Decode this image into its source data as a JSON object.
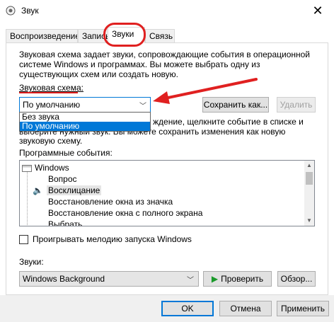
{
  "window": {
    "title": "Звук"
  },
  "tabs": [
    {
      "label": "Воспроизведение"
    },
    {
      "label": "Запись"
    },
    {
      "label": "Звуки"
    },
    {
      "label": "Связь"
    }
  ],
  "sounds_tab": {
    "description": "Звуковая схема задает звуки, сопровождающие события в операционной системе Windows и программах. Вы можете выбрать одну из существующих схем или создать новую.",
    "scheme_label": "Звуковая схема:",
    "scheme_selected": "По умолчанию",
    "scheme_options": [
      "Без звука",
      "По умолчанию"
    ],
    "save_as_label": "Сохранить как...",
    "delete_label": "Удалить",
    "change_hint_line1": "ждение, щелкните событие в списке и",
    "change_hint_line2": "выберите нужный звук. Вы можете сохранить изменения как новую звуковую схему.",
    "events_label": "Программные события:",
    "events": [
      {
        "label": "Windows"
      },
      {
        "label": "Вопрос"
      },
      {
        "label": "Восклицание"
      },
      {
        "label": "Восстановление окна из значка"
      },
      {
        "label": "Восстановление окна с полного экрана"
      },
      {
        "label": "Выбрать"
      }
    ],
    "startup_checkbox_label": "Проигрывать мелодию запуска Windows",
    "sounds_label": "Звуки:",
    "sound_selected": "Windows Background",
    "test_label": "Проверить",
    "browse_label": "Обзор..."
  },
  "footer": {
    "ok_label": "OK",
    "cancel_label": "Отмена",
    "apply_label": "Применить"
  },
  "colors": {
    "accent": "#0078d7",
    "annotation": "#e02020"
  }
}
